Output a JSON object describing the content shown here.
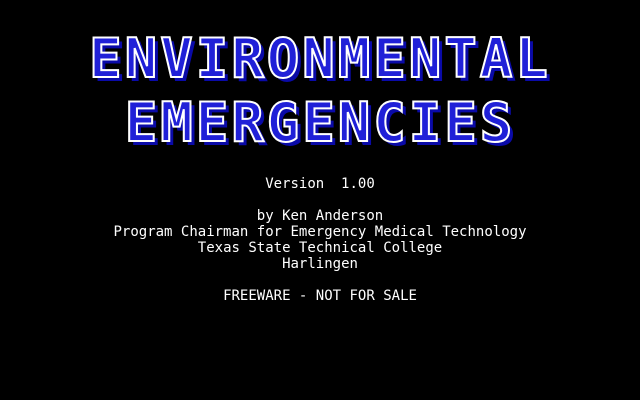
{
  "title": {
    "line1": "ENVIRONMENTAL",
    "line2": "EMERGENCIES",
    "fill_color": "#2020d8",
    "outline_color": "#ffffff",
    "shadow_color": "#0a0aa8"
  },
  "version": "Version  1.00",
  "credits": [
    "by Ken Anderson",
    "Program Chairman for Emergency Medical Technology",
    "Texas State Technical College",
    "Harlingen"
  ],
  "license": "FREEWARE - NOT FOR SALE",
  "colors": {
    "background": "#000000",
    "text": "#ffffff"
  }
}
